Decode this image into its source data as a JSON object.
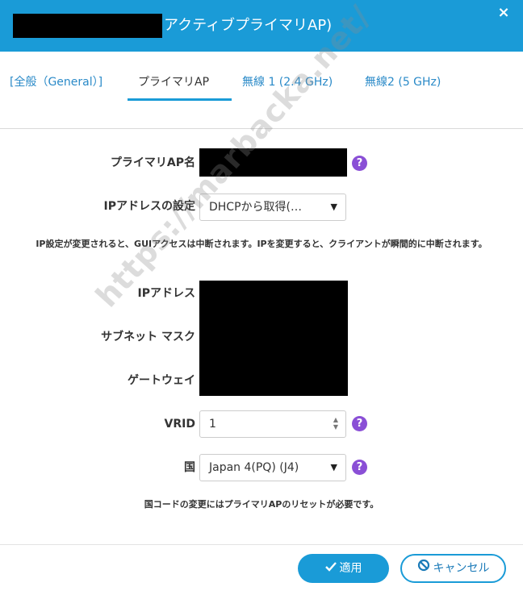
{
  "header": {
    "title": "アクティブプライマリAP)",
    "close_label": "×"
  },
  "tabs": [
    {
      "label": "[全般（General）]"
    },
    {
      "label": "プライマリAP"
    },
    {
      "label": "無線 1 (2.4 GHz)"
    },
    {
      "label": "無線2 (5 GHz)"
    }
  ],
  "form": {
    "primary_ap_name_label": "プライマリAP名",
    "ip_setting_label": "IPアドレスの設定",
    "ip_setting_value": "DHCPから取得(…",
    "ip_change_notice": "IP設定が変更されると、GUIアクセスは中断されます。IPを変更すると、クライアントが瞬間的に中断されます。",
    "ip_address_label": "IPアドレス",
    "subnet_mask_label": "サブネット マスク",
    "gateway_label": "ゲートウェイ",
    "vrid_label": "VRID",
    "vrid_value": "1",
    "country_label": "国",
    "country_value": "Japan 4(PQ) (J4)",
    "country_notice": "国コードの変更にはプライマリAPのリセットが必要です。",
    "help_glyph": "?"
  },
  "footer": {
    "apply_label": "適用",
    "cancel_label": "キャンセル"
  },
  "watermark": "https://marbacka.net/",
  "colors": {
    "header_bg": "#1a9bd7",
    "help_icon": "#8a4fd6",
    "tab_link": "#2a8ac8"
  }
}
